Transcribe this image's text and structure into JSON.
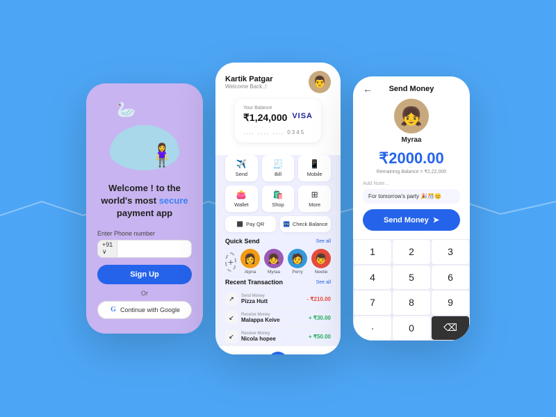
{
  "background": "#4DA6F5",
  "phone1": {
    "welcome_line1": "Welcome ! to the",
    "welcome_line2": "world's most",
    "welcome_secure": "secure",
    "welcome_line3": "payment app",
    "phone_label": "Enter Phone number",
    "country_code": "+91 ∨",
    "signup_btn": "Sign Up",
    "or_text": "Or",
    "google_btn": "Continue with Google"
  },
  "phone2": {
    "user_name": "Kartik Patgar",
    "welcome_back": "Welcome Back..!",
    "balance_label": "Your Balance",
    "balance": "₹1,24,000",
    "card_brand": "VISA",
    "card_number": ".... .... .... 0345",
    "actions": [
      {
        "icon": "✈️",
        "label": "Send"
      },
      {
        "icon": "🧾",
        "label": "Bill"
      },
      {
        "icon": "📱",
        "label": "Mobile"
      },
      {
        "icon": "👛",
        "label": "Wallet"
      },
      {
        "icon": "🛍️",
        "label": "Shop"
      },
      {
        "icon": "⊞",
        "label": "More"
      }
    ],
    "payqr_label": "Pay QR",
    "check_balance_label": "Check Balance",
    "quick_send_title": "Quick Send",
    "see_all": "See all",
    "contacts": [
      {
        "name": "Alpna",
        "color": "#f39c12",
        "emoji": "👩"
      },
      {
        "name": "Myraa",
        "color": "#9b59b6",
        "emoji": "👧"
      },
      {
        "name": "Perry",
        "color": "#3498db",
        "emoji": "🧑"
      },
      {
        "name": "Neetie",
        "color": "#e74c3c",
        "emoji": "👦"
      }
    ],
    "recent_title": "Recent Transaction",
    "transactions": [
      {
        "type": "Send Money",
        "name": "Pizza Hutt",
        "amount": "- ₹210.00",
        "kind": "debit"
      },
      {
        "type": "Receive Money",
        "name": "Malappa Keive",
        "amount": "+ ₹30.00",
        "kind": "credit"
      },
      {
        "type": "Receive Money",
        "name": "Nicola hopee",
        "amount": "+ ₹50.00",
        "kind": "credit"
      }
    ]
  },
  "phone3": {
    "title": "Send Money",
    "recipient_name": "Myraa",
    "amount": "₹2000.00",
    "remaining": "Remaining Balance = ₹2,22,000",
    "note_label": "Add Note...",
    "note_value": "For tomorrow's party 🎉🎊😊",
    "send_btn": "Send Money",
    "keypad": [
      "1",
      "2",
      "3",
      "4",
      "5",
      "6",
      "7",
      "8",
      "9",
      "·",
      "0",
      "⌫"
    ]
  }
}
